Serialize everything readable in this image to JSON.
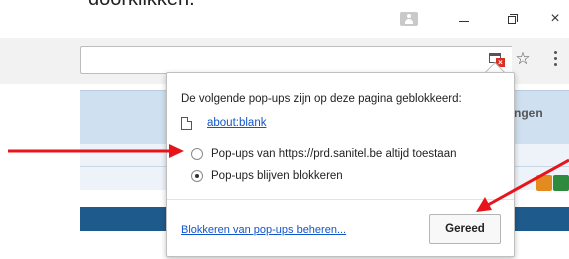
{
  "caption": {
    "text": "doorklikken."
  },
  "window_controls": {
    "profile_icon": "person-icon",
    "minimize_icon": "minimize-icon",
    "restore_icon": "restore-icon",
    "close_icon": "close-icon",
    "close_glyph": "×"
  },
  "toolbar": {
    "popup_blocked_icon": "popup-blocked-icon",
    "star_icon": "star-icon",
    "star_glyph": "☆",
    "menu_icon": "more-vert-icon"
  },
  "page_background": {
    "band_text": "ngen"
  },
  "popup": {
    "title": "De volgende pop-ups zijn op deze pagina geblokkeerd:",
    "blocked_item": "about:blank",
    "blocked_item_icon": "document-icon",
    "options": [
      {
        "label": "Pop-ups van https://prd.sanitel.be altijd toestaan",
        "checked": false
      },
      {
        "label": "Pop-ups blijven blokkeren",
        "checked": true
      }
    ],
    "manage_link": "Blokkeren van pop-ups beheren...",
    "done_button": "Gereed"
  },
  "annotations": {
    "arrow_color": "#e8141b"
  }
}
